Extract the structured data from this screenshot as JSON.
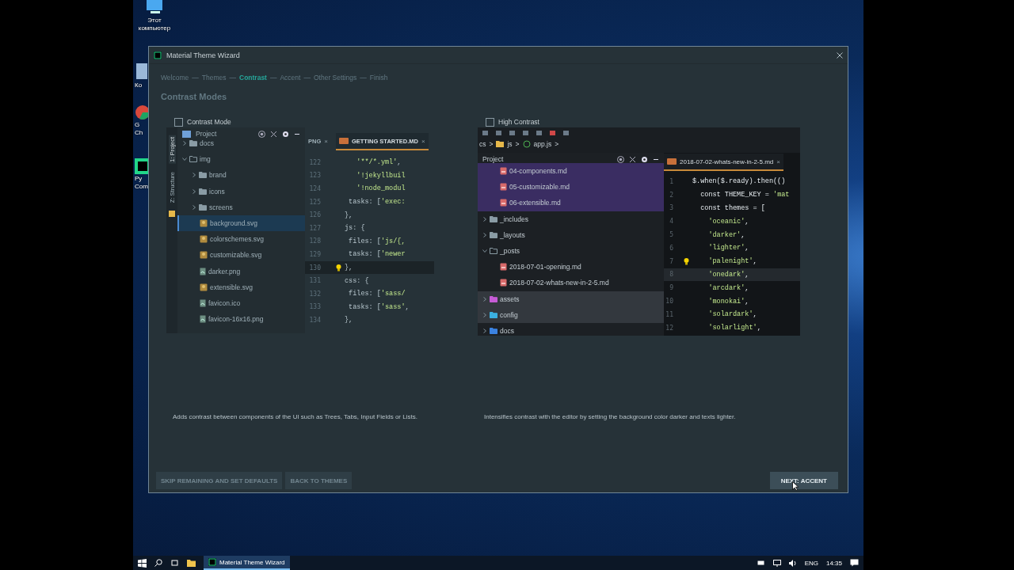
{
  "desktop": {
    "icons": [
      {
        "kind": "computer",
        "lines": [
          "Этот",
          "компьютер"
        ]
      },
      {
        "kind": "bin",
        "lines": [
          "Ко"
        ]
      },
      {
        "kind": "chrome",
        "lines": [
          "G",
          "Ch"
        ]
      },
      {
        "kind": "pycharm",
        "lines": [
          "Py",
          "Com"
        ]
      }
    ]
  },
  "window": {
    "title": "Material Theme Wizard"
  },
  "wizard": {
    "separator": "—",
    "steps": [
      {
        "label": "Welcome",
        "selected": false
      },
      {
        "label": "Themes",
        "selected": false
      },
      {
        "label": "Contrast",
        "selected": true
      },
      {
        "label": "Accent",
        "selected": false
      },
      {
        "label": "Other Settings",
        "selected": false
      },
      {
        "label": "Finish",
        "selected": false
      }
    ],
    "heading": "Contrast Modes",
    "options": [
      {
        "label": "Contrast Mode",
        "checked": false,
        "description": "Adds contrast between components of the UI such as Trees, Tabs, Input Fields or Lists.",
        "preview": {
          "kind": "contrast",
          "tool_tabs": [
            {
              "label": "1: Project",
              "selected": true
            },
            {
              "label": "Z: Structure",
              "selected": false
            }
          ],
          "panel_title": "Project",
          "tree": [
            {
              "label": "docs",
              "kind": "folder",
              "expanded": false
            },
            {
              "label": "img",
              "kind": "folder",
              "expanded": true,
              "children": [
                {
                  "label": "brand",
                  "kind": "folder",
                  "expanded": false
                },
                {
                  "label": "icons",
                  "kind": "folder",
                  "expanded": false
                },
                {
                  "label": "screens",
                  "kind": "folder",
                  "expanded": false
                },
                {
                  "label": "background.svg",
                  "kind": "vector",
                  "selected": true
                },
                {
                  "label": "colorschemes.svg",
                  "kind": "vector",
                  "selected": false
                },
                {
                  "label": "customizable.svg",
                  "kind": "vector",
                  "selected": false
                },
                {
                  "label": "darker.png",
                  "kind": "image",
                  "selected": false
                },
                {
                  "label": "extensible.svg",
                  "kind": "vector",
                  "selected": false
                },
                {
                  "label": "favicon.ico",
                  "kind": "image",
                  "selected": false
                },
                {
                  "label": "favicon-16x16.png",
                  "kind": "image",
                  "selected": false
                }
              ]
            }
          ],
          "close": "×",
          "tabs": [
            {
              "label": "PNG",
              "selected": false
            },
            {
              "label": "GETTING STARTED.MD",
              "selected": true
            }
          ],
          "code": [
            {
              "n": "122",
              "text": "   '**/*.yml',"
            },
            {
              "n": "123",
              "text": "   '!jekyllbuil"
            },
            {
              "n": "124",
              "text": "   '!node_modul"
            },
            {
              "n": "125",
              "text": " tasks: ['exec:"
            },
            {
              "n": "126",
              "text": "},"
            },
            {
              "n": "127",
              "text": "js: {"
            },
            {
              "n": "128",
              "text": " files: ['js/{,"
            },
            {
              "n": "129",
              "text": " tasks: ['newer"
            },
            {
              "n": "130",
              "text": "},",
              "current": true,
              "bulb": true
            },
            {
              "n": "131",
              "text": "css: {"
            },
            {
              "n": "132",
              "text": " files: ['sass/"
            },
            {
              "n": "133",
              "text": " tasks: ['sass',"
            },
            {
              "n": "134",
              "text": "},"
            }
          ]
        }
      },
      {
        "label": "High Contrast",
        "checked": false,
        "description": "Intensifies contrast with the editor by setting the background color darker and texts lighter.",
        "preview": {
          "kind": "high_contrast",
          "crumbs": [
            "cs",
            "js",
            "app.js"
          ],
          "crumb_separator": ">",
          "panel_title": "Project",
          "tree": [
            {
              "children": [
                {
                  "label": "04-components.md",
                  "kind": "markdown",
                  "selected": true
                },
                {
                  "label": "05-customizable.md",
                  "kind": "markdown",
                  "selected": true
                },
                {
                  "label": "06-extensible.md",
                  "kind": "markdown",
                  "selected": true
                }
              ]
            },
            {
              "label": "_includes",
              "kind": "folder",
              "expanded": false
            },
            {
              "label": "_layouts",
              "kind": "folder",
              "expanded": false
            },
            {
              "label": "_posts",
              "kind": "folder",
              "expanded": true,
              "children": [
                {
                  "label": "2018-07-01-opening.md",
                  "kind": "markdown",
                  "selected": false
                },
                {
                  "label": "2018-07-02-whats-new-in-2-5.md",
                  "kind": "markdown",
                  "selected": false
                }
              ]
            },
            {
              "label": "assets",
              "kind": "folder",
              "expanded": false,
              "highlighted": true,
              "color": "#c65cd6"
            },
            {
              "label": "config",
              "kind": "folder",
              "expanded": false,
              "highlighted": true,
              "color": "#3bb0e0"
            },
            {
              "label": "docs",
              "kind": "folder",
              "expanded": false,
              "highlighted": false,
              "color": "#3b82e0"
            }
          ],
          "close": "×",
          "tabs": [
            {
              "label": "2018-07-02-whats-new-in-2-5.md",
              "selected": true
            }
          ],
          "code": [
            {
              "n": "1",
              "text": "$.when($.ready).then(()"
            },
            {
              "n": "2",
              "text": "  const THEME_KEY = 'mat"
            },
            {
              "n": "3",
              "text": "  const themes = ["
            },
            {
              "n": "4",
              "text": "    'oceanic',"
            },
            {
              "n": "5",
              "text": "    'darker',"
            },
            {
              "n": "6",
              "text": "    'lighter',"
            },
            {
              "n": "7",
              "text": "    'palenight',",
              "bulb": true
            },
            {
              "n": "8",
              "text": "    'onedark',",
              "current": true
            },
            {
              "n": "9",
              "text": "    'arcdark',"
            },
            {
              "n": "10",
              "text": "    'monokai',"
            },
            {
              "n": "11",
              "text": "    'solardark',"
            },
            {
              "n": "12",
              "text": "    'solarlight',"
            }
          ]
        }
      }
    ]
  },
  "buttons": [
    {
      "label": "SKIP REMAINING AND SET DEFAULTS",
      "kind": "secondary"
    },
    {
      "label": "BACK TO THEMES",
      "kind": "secondary"
    },
    {
      "label": "NEXT: ACCENT",
      "kind": "primary"
    }
  ],
  "taskbar": {
    "app": {
      "title": "Material Theme Wizard",
      "selected": true
    },
    "language": "ENG",
    "time": "14:35"
  }
}
